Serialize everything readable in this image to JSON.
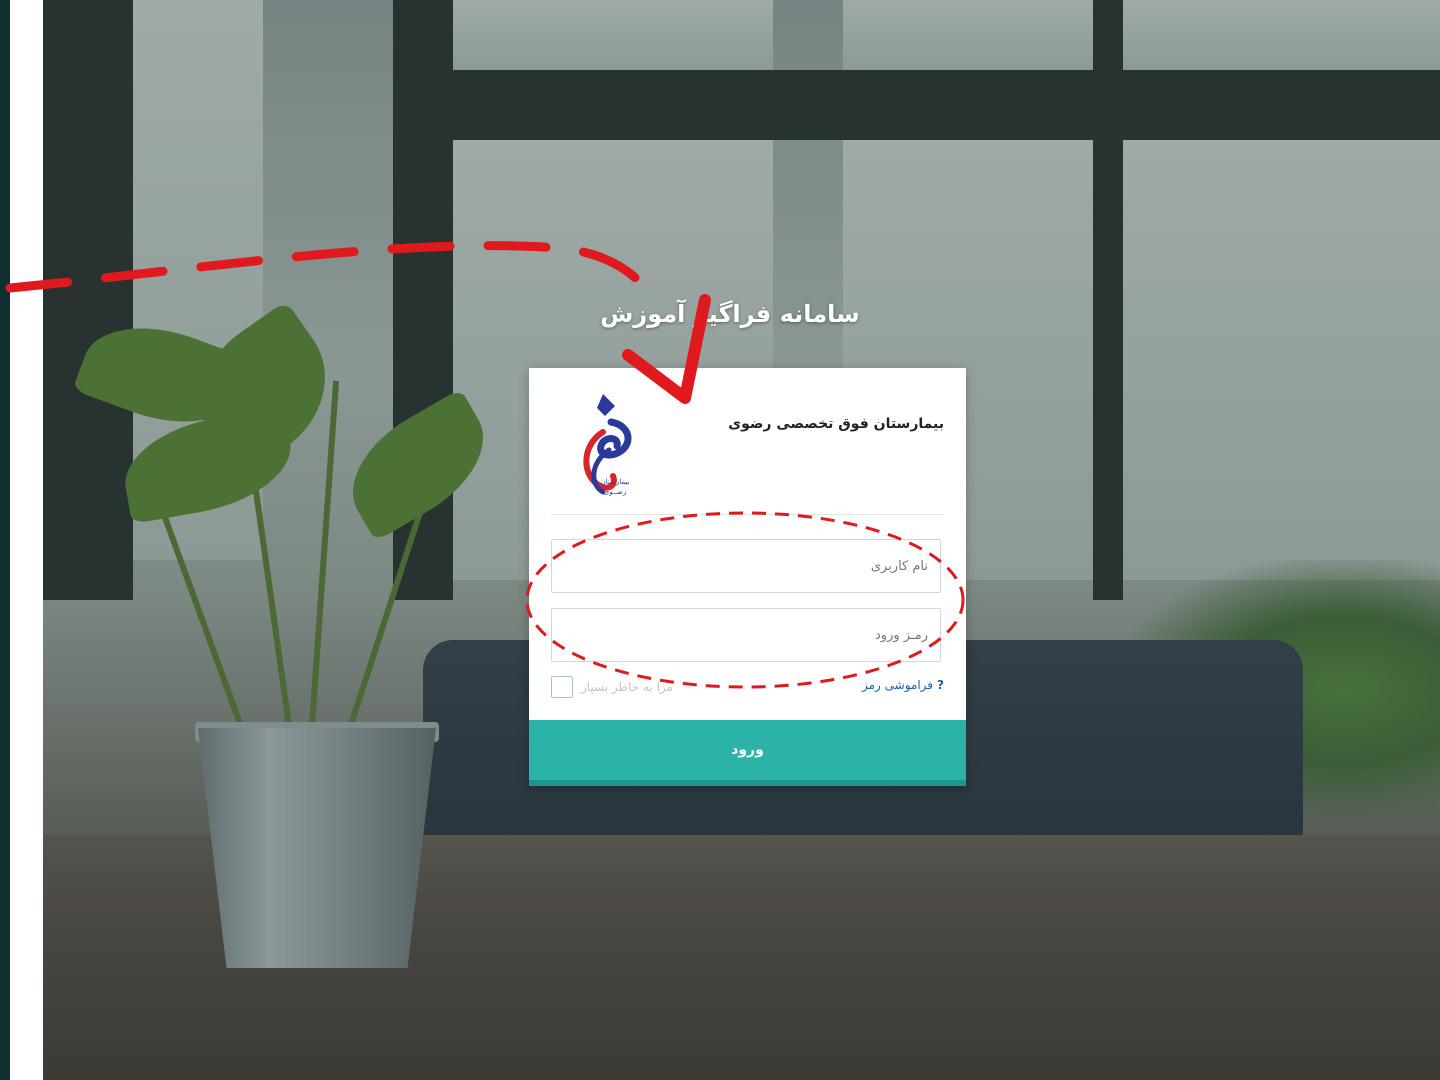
{
  "page": {
    "title": "سامانه فراگیر آموزش"
  },
  "card": {
    "hospital_name": "بیمارستان فوق تخصصی رضوی",
    "logo_text_line1": "بیمارستان",
    "logo_text_line2": "رضــوی"
  },
  "form": {
    "username_placeholder": "نام کاربری",
    "username_value": "",
    "password_placeholder": "رمـز ورود",
    "password_value": "",
    "forgot_label": "فراموشی رمز",
    "forgot_icon": "?",
    "remember_label": "مرا به خاطر بسپار",
    "remember_checked": false,
    "submit_label": "ورود"
  },
  "colors": {
    "accent": "#2ab3a6",
    "link": "#1a5fb4",
    "annotation": "#e0191e"
  },
  "icons": {
    "help": "question-mark-icon",
    "logo": "hospital-logo"
  }
}
